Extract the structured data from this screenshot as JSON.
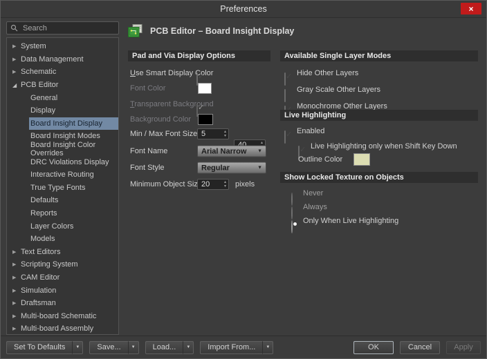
{
  "window": {
    "title": "Preferences"
  },
  "icons": {
    "close": "×",
    "dropdown_arrow": "▼",
    "spinner_up": "▴",
    "spinner_down": "▾",
    "tree_collapsed": "▶",
    "tree_expanded": "◢"
  },
  "colors": {
    "tree_selection_bg": "#7289a4",
    "close_button_bg": "#c11b1b",
    "section_header_bg": "#2e2e2e"
  },
  "sidebar": {
    "search": {
      "placeholder": "Search"
    },
    "tree": [
      {
        "label": "System",
        "level": 0,
        "expanded": false
      },
      {
        "label": "Data Management",
        "level": 0,
        "expanded": false
      },
      {
        "label": "Schematic",
        "level": 0,
        "expanded": false
      },
      {
        "label": "PCB Editor",
        "level": 0,
        "expanded": true
      },
      {
        "label": "General",
        "level": 1,
        "selected": false
      },
      {
        "label": "Display",
        "level": 1,
        "selected": false
      },
      {
        "label": "Board Insight Display",
        "level": 1,
        "selected": true
      },
      {
        "label": "Board Insight Modes",
        "level": 1,
        "selected": false
      },
      {
        "label": "Board Insight Color Overrides",
        "level": 1,
        "selected": false
      },
      {
        "label": "DRC Violations Display",
        "level": 1,
        "selected": false
      },
      {
        "label": "Interactive Routing",
        "level": 1,
        "selected": false
      },
      {
        "label": "True Type Fonts",
        "level": 1,
        "selected": false
      },
      {
        "label": "Defaults",
        "level": 1,
        "selected": false
      },
      {
        "label": "Reports",
        "level": 1,
        "selected": false
      },
      {
        "label": "Layer Colors",
        "level": 1,
        "selected": false
      },
      {
        "label": "Models",
        "level": 1,
        "selected": false
      },
      {
        "label": "Text Editors",
        "level": 0,
        "expanded": false
      },
      {
        "label": "Scripting System",
        "level": 0,
        "expanded": false
      },
      {
        "label": "CAM Editor",
        "level": 0,
        "expanded": false
      },
      {
        "label": "Simulation",
        "level": 0,
        "expanded": false
      },
      {
        "label": "Draftsman",
        "level": 0,
        "expanded": false
      },
      {
        "label": "Multi-board Schematic",
        "level": 0,
        "expanded": false
      },
      {
        "label": "Multi-board Assembly",
        "level": 0,
        "expanded": false
      }
    ]
  },
  "page": {
    "title": "PCB Editor – Board Insight Display"
  },
  "pad_via": {
    "section_title": "Pad and Via Display Options",
    "use_smart_display_color": {
      "label": "Use Smart Display Color",
      "checked": true
    },
    "font_color": {
      "label": "Font Color",
      "value": "#ffffff",
      "enabled": false
    },
    "transparent_background": {
      "label": "Transparent Background",
      "checked": true,
      "enabled": false
    },
    "background_color": {
      "label": "Background Color",
      "value": "#000000",
      "enabled": false
    },
    "min_max_font_size": {
      "label": "Min / Max Font Size",
      "min_value": "5",
      "max_value": "40"
    },
    "font_name": {
      "label": "Font Name",
      "value": "Arial Narrow"
    },
    "font_style": {
      "label": "Font Style",
      "value": "Regular"
    },
    "minimum_object_size": {
      "label": "Minimum Object Size",
      "value": "20",
      "unit": "pixels"
    }
  },
  "single_layer": {
    "section_title": "Available Single Layer Modes",
    "hide_other_layers": {
      "label": "Hide Other Layers",
      "checked": true
    },
    "gray_scale_other_layers": {
      "label": "Gray Scale Other Layers",
      "checked": false
    },
    "monochrome_other_layers": {
      "label": "Monochrome Other Layers",
      "checked": true
    }
  },
  "live_highlighting": {
    "section_title": "Live Highlighting",
    "enabled": {
      "label": "Enabled",
      "checked": true
    },
    "shift_key_only": {
      "label": "Live Highlighting only when Shift Key Down",
      "checked": true
    },
    "outline_color": {
      "label": "Outline Color",
      "value": "#dcddb2"
    }
  },
  "locked_texture": {
    "section_title": "Show Locked Texture on Objects",
    "never": {
      "label": "Never",
      "selected": false
    },
    "always": {
      "label": "Always",
      "selected": false
    },
    "only_when_live_highlighting": {
      "label": "Only When Live Highlighting",
      "selected": true
    }
  },
  "footer": {
    "set_to_defaults": "Set To Defaults",
    "save": "Save...",
    "load": "Load...",
    "import_from": "Import From...",
    "ok": "OK",
    "cancel": "Cancel",
    "apply": "Apply"
  }
}
